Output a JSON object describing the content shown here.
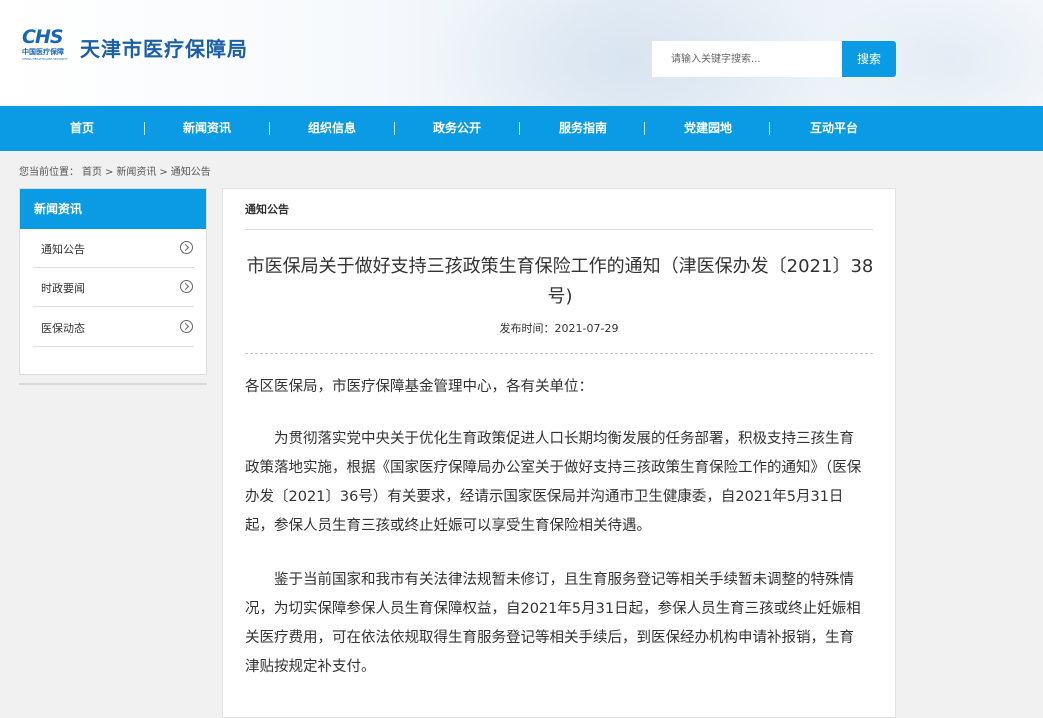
{
  "header": {
    "logo_mark": "CHS",
    "logo_sub1": "中国医疗保障",
    "logo_sub2": "CHINA HEALTHCARE SECURITY",
    "site_title": "天津市医疗保障局",
    "search_placeholder": "请输入关键字搜索...",
    "search_button": "搜索"
  },
  "nav": {
    "items": [
      "首页",
      "新闻资讯",
      "组织信息",
      "政务公开",
      "服务指南",
      "党建园地",
      "互动平台"
    ]
  },
  "breadcrumb": {
    "prefix": "您当前位置：",
    "items": [
      "首页",
      ">",
      "新闻资讯",
      ">",
      "通知公告"
    ]
  },
  "sidebar": {
    "heading": "新闻资讯",
    "items": [
      "通知公告",
      "时政要闻",
      "医保动态"
    ]
  },
  "main": {
    "section": "通知公告",
    "title": "市医保局关于做好支持三孩政策生育保险工作的通知（津医保办发〔2021〕38号)",
    "pubdate": "发布时间：2021-07-29",
    "paragraphs": [
      "各区医保局，市医疗保障基金管理中心，各有关单位：",
      "为贯彻落实党中央关于优化生育政策促进人口长期均衡发展的任务部署，积极支持三孩生育政策落地实施，根据《国家医疗保障局办公室关于做好支持三孩政策生育保险工作的通知》（医保办发〔2021〕36号）有关要求，经请示国家医保局并沟通市卫生健康委，自2021年5月31日起，参保人员生育三孩或终止妊娠可以享受生育保险相关待遇。",
      "鉴于当前国家和我市有关法律法规暂未修订，且生育服务登记等相关手续暂未调整的特殊情况，为切实保障参保人员生育保障权益，自2021年5月31日起，参保人员生育三孩或终止妊娠相关医疗费用，可在依法依规取得生育服务登记等相关手续后，到医保经办机构申请补报销，生育津贴按规定补支付。"
    ]
  }
}
